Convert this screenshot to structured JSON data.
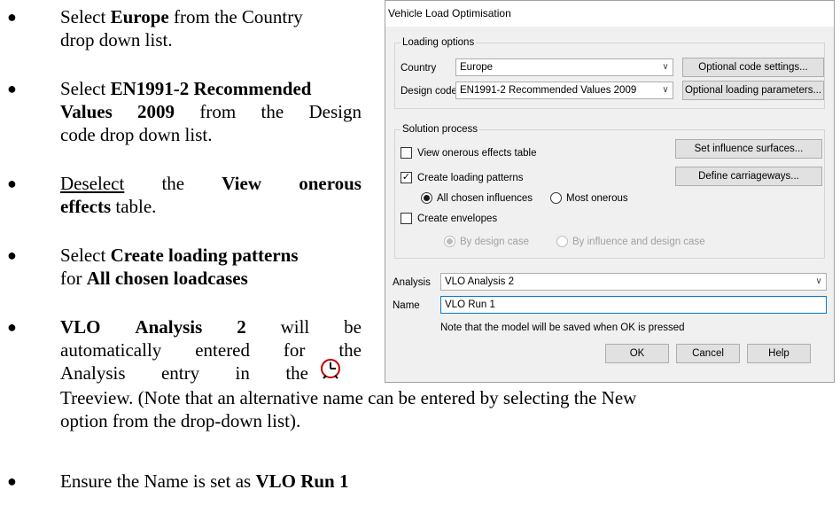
{
  "instructions": {
    "b1": {
      "t1": "Select ",
      "b": "Europe",
      "t2": " from the Country",
      "line2": "drop down list."
    },
    "b2": {
      "t1": "Select ",
      "b": "EN1991-2 Recommended",
      "l2b": "Values 2009",
      "l2t": " from the Design",
      "line3": "code drop down list."
    },
    "b3": {
      "u": "Deselect",
      "t": "the",
      "b1": "View",
      "b2": "onerous",
      "l2b": "effects",
      "l2t": " table."
    },
    "b4": {
      "t1": "Select ",
      "b": "Create loading patterns",
      "l2t": "for ",
      "l2b": "All chosen loadcases"
    },
    "b5": {
      "b1": "VLO",
      "b2": "Analysis",
      "b3": "2",
      "w1": "will",
      "w2": "be",
      "l2": "automatically entered for the",
      "l3a": "Analysis",
      "l3b": "entry",
      "l3c": "in",
      "l3d": "the",
      "l4": "Treeview. (Note that an alternative name can be entered by selecting the New",
      "l5": "option from the drop-down list)."
    },
    "b6": {
      "t": "Ensure the Name is set as ",
      "b": "VLO Run 1"
    }
  },
  "dialog": {
    "title": "Vehicle Load Optimisation",
    "loading_options": {
      "title": "Loading options",
      "country_label": "Country",
      "country_value": "Europe",
      "design_code_label": "Design code",
      "design_code_value": "EN1991-2 Recommended Values 2009",
      "optional_code_button": "Optional code settings...",
      "optional_loading_button": "Optional loading parameters..."
    },
    "solution_process": {
      "title": "Solution process",
      "view_onerous_label": "View onerous effects table",
      "view_onerous_checked": false,
      "create_loading_label": "Create loading patterns",
      "create_loading_checked": true,
      "all_chosen_label": "All chosen influences",
      "most_onerous_label": "Most onerous",
      "create_envelopes_label": "Create envelopes",
      "create_envelopes_checked": false,
      "by_design_case_label": "By design case",
      "by_influence_label": "By influence and design case",
      "set_influence_button": "Set influence surfaces...",
      "define_carriageways_button": "Define carriageways..."
    },
    "analysis_label": "Analysis",
    "analysis_value": "VLO Analysis 2",
    "name_label": "Name",
    "name_value": "VLO Run 1",
    "note": "Note that the model will be saved when OK is pressed",
    "ok_button": "OK",
    "cancel_button": "Cancel",
    "help_button": "Help"
  },
  "icons": {
    "treeview": "clock-icon",
    "checkmark": "✓",
    "dropdown": "chevron-down-icon"
  }
}
